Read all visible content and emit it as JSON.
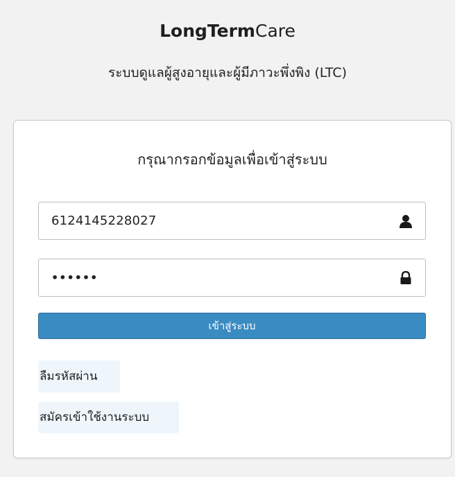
{
  "header": {
    "brand_strong": "LongTerm",
    "brand_light": "Care",
    "subtitle": "ระบบดูแลผู้สูงอายุและผู้มีภาวะพึ่งพิง (LTC)"
  },
  "login": {
    "title": "กรุณากรอกข้อมูลเพื่อเข้าสู่ระบบ",
    "username_value": "6124145228027",
    "password_value": "••••••",
    "username_icon": "user-icon",
    "password_icon": "lock-icon",
    "submit_label": "เข้าสู่ระบบ",
    "forgot_label": "ลืมรหัสผ่าน",
    "register_label": "สมัครเข้าใช้งานระบบ"
  },
  "colors": {
    "page_background": "#f2f2f2",
    "button": "#3a8bc1",
    "link_background": "#eef6fc"
  }
}
